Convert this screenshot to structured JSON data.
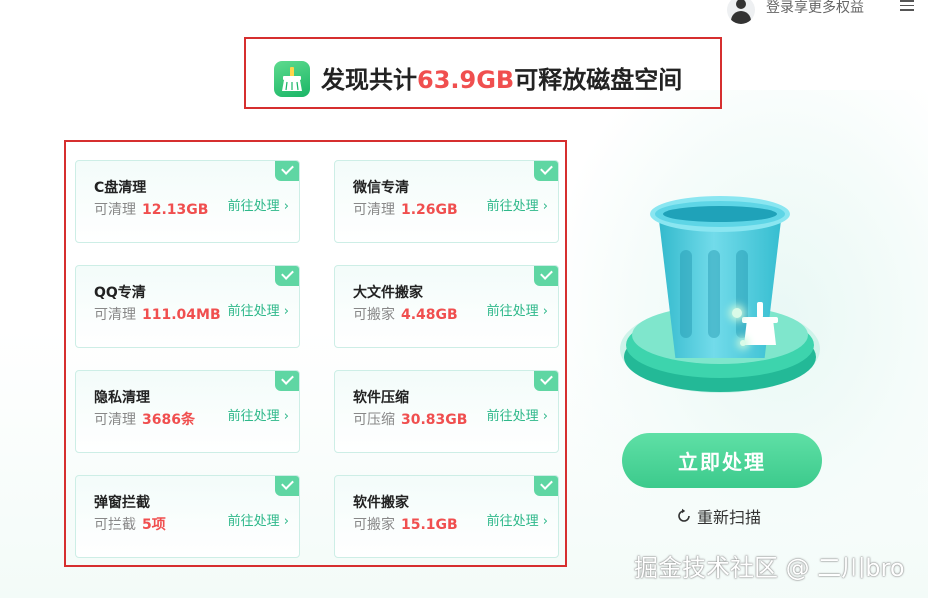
{
  "topbar": {
    "login_text": "登录享更多权益"
  },
  "headline": {
    "prefix": "发现共计",
    "highlight": "63.9GB",
    "suffix": "可释放磁盘空间"
  },
  "cards": [
    {
      "title": "C盘清理",
      "sub_label": "可清理",
      "value": "12.13GB",
      "action": "前往处理 ›",
      "checked": true
    },
    {
      "title": "微信专清",
      "sub_label": "可清理",
      "value": "1.26GB",
      "action": "前往处理 ›",
      "checked": true
    },
    {
      "title": "QQ专清",
      "sub_label": "可清理",
      "value": "111.04MB",
      "action": "前往处理 ›",
      "checked": true
    },
    {
      "title": "大文件搬家",
      "sub_label": "可搬家",
      "value": "4.48GB",
      "action": "前往处理 ›",
      "checked": true
    },
    {
      "title": "隐私清理",
      "sub_label": "可清理",
      "value": "3686条",
      "action": "前往处理 ›",
      "checked": true
    },
    {
      "title": "软件压缩",
      "sub_label": "可压缩",
      "value": "30.83GB",
      "action": "前往处理 ›",
      "checked": true
    },
    {
      "title": "弹窗拦截",
      "sub_label": "可拦截",
      "value": "5项",
      "action": "前往处理 ›",
      "checked": true
    },
    {
      "title": "软件搬家",
      "sub_label": "可搬家",
      "value": "15.1GB",
      "action": "前往处理 ›",
      "checked": true
    }
  ],
  "actions": {
    "primary": "立即处理",
    "rescan": "重新扫描"
  },
  "watermark": "掘金技术社区 @ 二川bro",
  "colors": {
    "accent": "#3cca8c",
    "highlight": "#f04f4f",
    "link": "#2eb88a",
    "annotation_border": "#d62f2f"
  }
}
